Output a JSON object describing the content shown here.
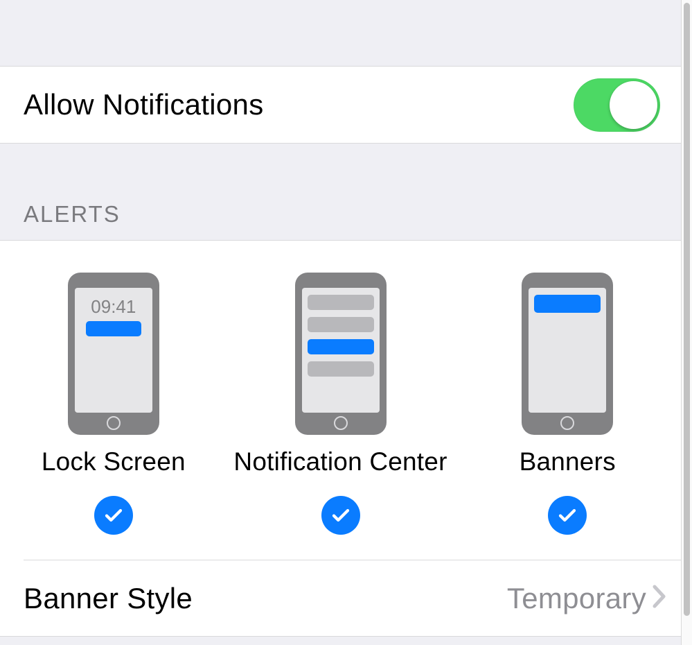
{
  "rows": {
    "allow_notifications": {
      "label": "Allow Notifications",
      "on": true
    },
    "banner_style": {
      "label": "Banner Style",
      "value": "Temporary"
    }
  },
  "sections": {
    "alerts_header": "ALERTS"
  },
  "alerts": {
    "lock_screen": {
      "label": "Lock Screen",
      "time": "09:41",
      "checked": true
    },
    "notification_center": {
      "label": "Notification Center",
      "checked": true
    },
    "banners": {
      "label": "Banners",
      "checked": true
    }
  },
  "colors": {
    "accent_blue": "#0a7cff",
    "switch_green": "#4cd964"
  }
}
